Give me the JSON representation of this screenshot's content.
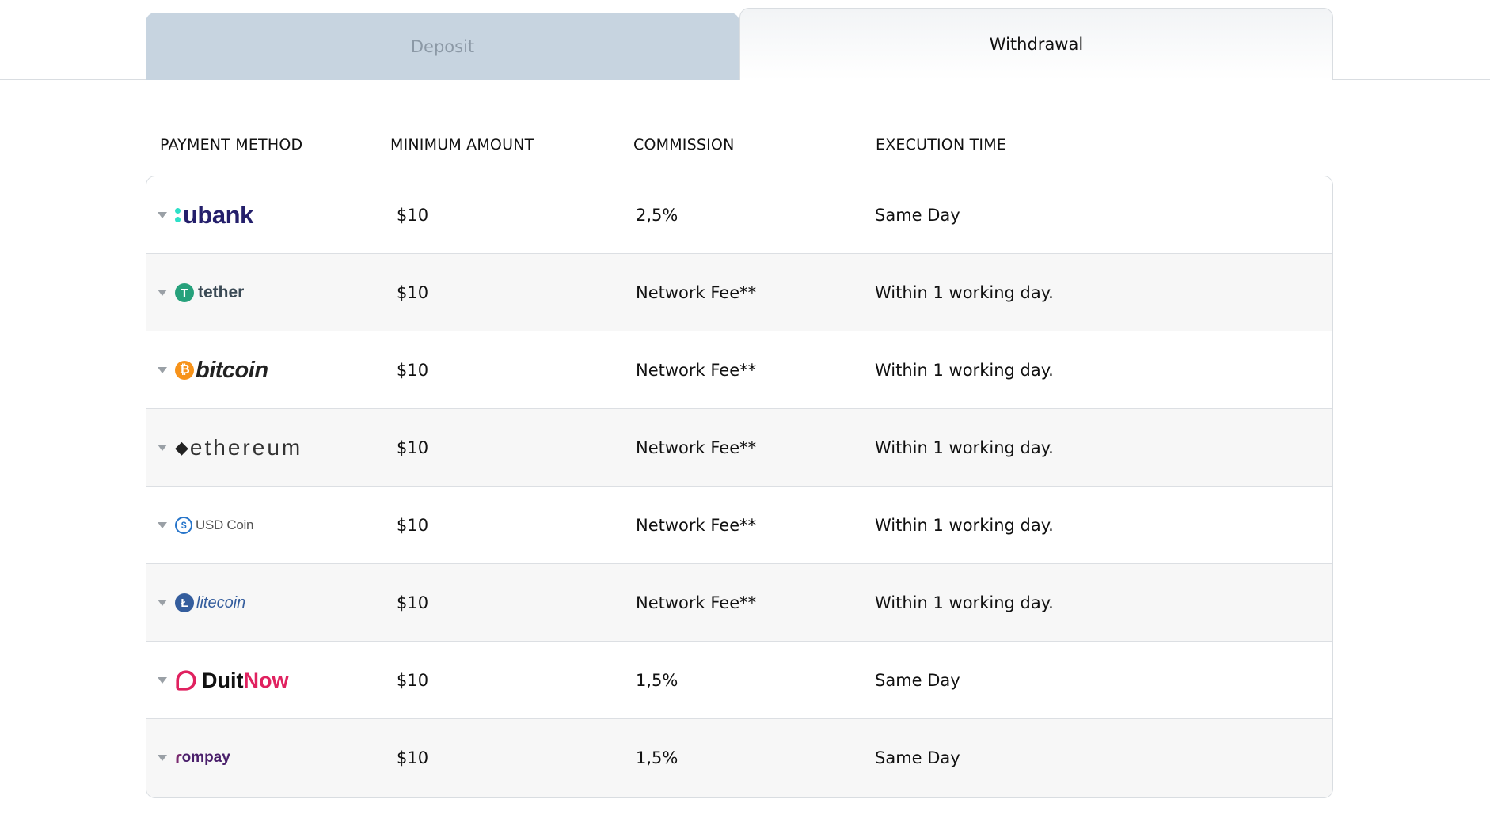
{
  "tabs": {
    "deposit": "Deposit",
    "withdrawal": "Withdrawal",
    "active": "withdrawal"
  },
  "table": {
    "headers": [
      "PAYMENT METHOD",
      "MINIMUM AMOUNT",
      "COMMISSION",
      "EXECUTION TIME"
    ],
    "rows": [
      {
        "method": "ubank",
        "min": "$10",
        "commission": "2,5%",
        "time": "Same Day"
      },
      {
        "method": "tether",
        "min": "$10",
        "commission": "Network Fee**",
        "time": "Within 1 working day."
      },
      {
        "method": "bitcoin",
        "min": "$10",
        "commission": "Network Fee**",
        "time": "Within 1 working day."
      },
      {
        "method": "ethereum",
        "min": "$10",
        "commission": "Network Fee**",
        "time": "Within 1 working day."
      },
      {
        "method": "USD Coin",
        "min": "$10",
        "commission": "Network Fee**",
        "time": "Within 1 working day."
      },
      {
        "method": "litecoin",
        "min": "$10",
        "commission": "Network Fee**",
        "time": "Within 1 working day."
      },
      {
        "method": "DuitNow",
        "min": "$10",
        "commission": "1,5%",
        "time": "Same Day"
      },
      {
        "method": "rompay",
        "min": "$10",
        "commission": "1,5%",
        "time": "Same Day"
      }
    ]
  },
  "logos": {
    "ubank": "ubank",
    "tether": "tether",
    "bitcoin": "bitcoin",
    "ethereum": "ethereum",
    "usdc": "USD Coin",
    "litecoin": "litecoin",
    "duitnow_a": "Duit",
    "duitnow_b": "Now",
    "rompay": "ompay"
  },
  "colors": {
    "tab_inactive": "#c7d4e0",
    "ubank": "#241f6b",
    "tether": "#26a17b",
    "bitcoin": "#f7931a",
    "usdc": "#2775ca",
    "litecoin": "#345d9d",
    "duitnow": "#e0215f"
  },
  "icons": [
    "chevron-down-icon",
    "tether-coin-icon",
    "bitcoin-coin-icon",
    "ethereum-icon",
    "usdc-coin-icon",
    "litecoin-coin-icon",
    "duitnow-icon"
  ]
}
